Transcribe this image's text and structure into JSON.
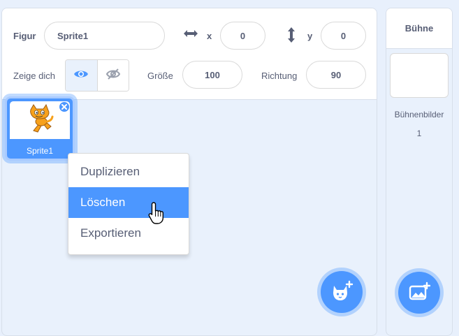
{
  "sprite_info": {
    "sprite_label": "Figur",
    "sprite_name": "Sprite1",
    "x_label": "x",
    "x_value": "0",
    "y_label": "y",
    "y_value": "0",
    "show_label": "Zeige dich",
    "size_label": "Größe",
    "size_value": "100",
    "direction_label": "Richtung",
    "direction_value": "90"
  },
  "sprite_tile": {
    "name": "Sprite1",
    "selected": true
  },
  "context_menu": {
    "items": [
      {
        "label": "Duplizieren"
      },
      {
        "label": "Löschen"
      },
      {
        "label": "Exportieren"
      }
    ],
    "active_index": 1
  },
  "stage": {
    "title": "Bühne",
    "backdrops_label": "Bühnenbilder",
    "backdrops_count": "1"
  },
  "colors": {
    "accent": "#4c97ff",
    "text": "#575e75",
    "background": "#e9f1fc"
  },
  "icons": {
    "choose_sprite": "cat-plus-icon",
    "choose_backdrop": "image-plus-icon",
    "show": "eye-icon",
    "hide": "eye-slash-icon",
    "x_axis": "horizontal-arrows-icon",
    "y_axis": "vertical-arrows-icon",
    "delete": "close-icon"
  }
}
